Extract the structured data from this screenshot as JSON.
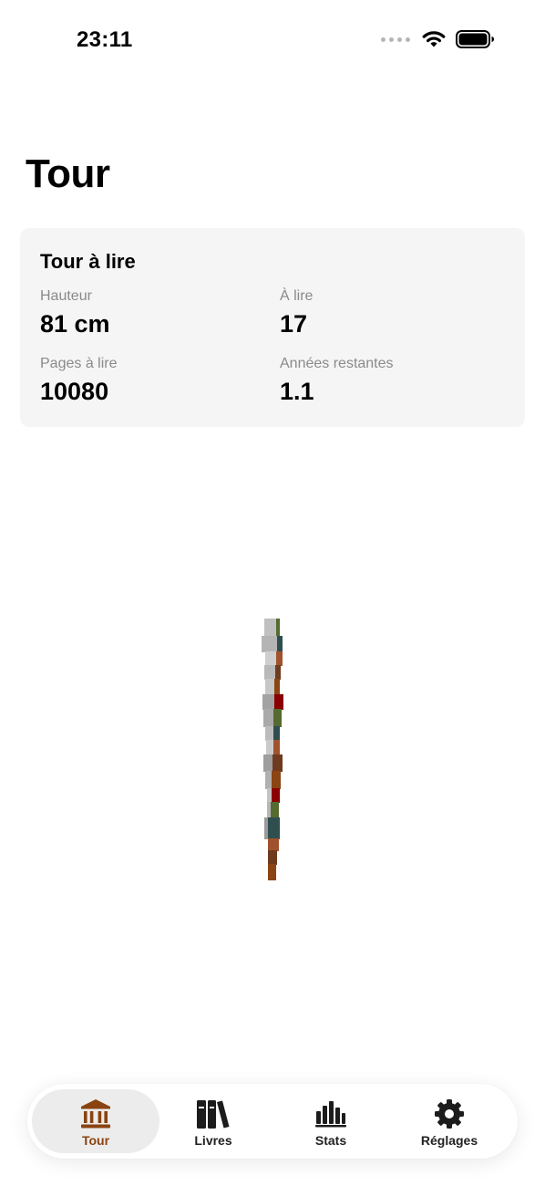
{
  "status_bar": {
    "time": "23:11",
    "icons": [
      "signal-dots-icon",
      "wifi-icon",
      "battery-icon"
    ]
  },
  "page": {
    "title": "Tour"
  },
  "summary_card": {
    "title": "Tour à lire",
    "stats": [
      {
        "label": "Hauteur",
        "value": "81 cm"
      },
      {
        "label": "À lire",
        "value": "17"
      },
      {
        "label": "Pages à lire",
        "value": "10080"
      },
      {
        "label": "Années restantes",
        "value": "1.1"
      }
    ]
  },
  "tower": {
    "book_count": 17,
    "colors": {
      "gray": "#a9a9a9",
      "light_gray": "#c7c7c7",
      "brown": "#8b4513",
      "dark_brown": "#6e3b1f",
      "rust": "#a0522d",
      "dark_red": "#8b0000",
      "olive": "#556b2f",
      "teal": "#2f4f4f"
    }
  },
  "tab_bar": {
    "accent": "#8a4310",
    "tabs": [
      {
        "label": "Tour",
        "icon": "bank-icon",
        "active": true
      },
      {
        "label": "Livres",
        "icon": "books-icon",
        "active": false
      },
      {
        "label": "Stats",
        "icon": "chart-bars-icon",
        "active": false
      },
      {
        "label": "Réglages",
        "icon": "gear-icon",
        "active": false
      }
    ]
  }
}
